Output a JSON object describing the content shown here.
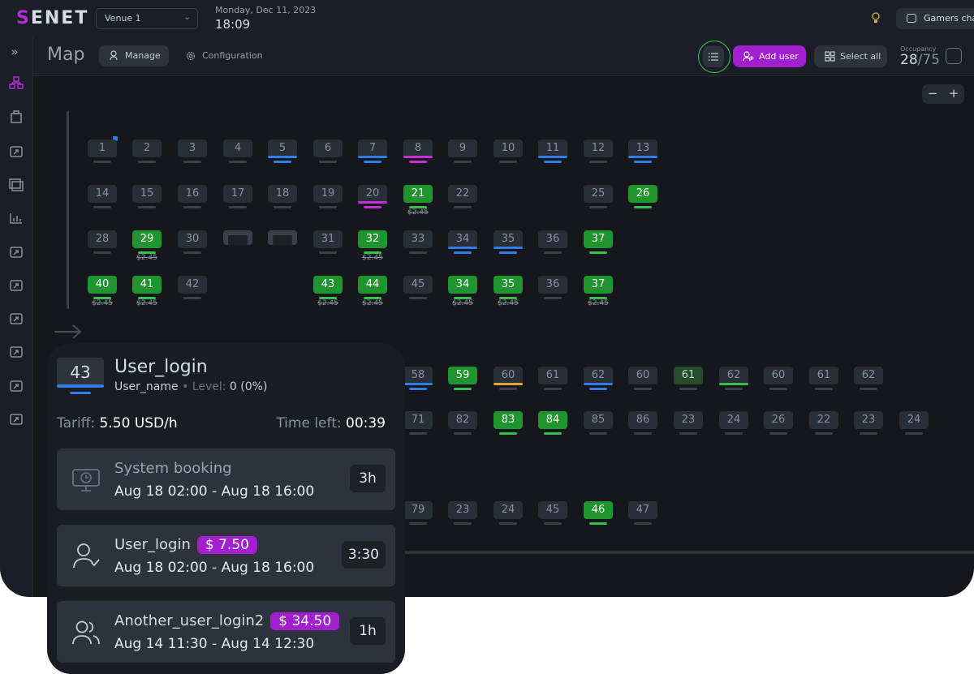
{
  "app": {
    "logo_s": "S",
    "logo_rest": "ENET"
  },
  "header": {
    "venue": "Venue 1",
    "date": "Monday, Dec 11, 2023",
    "time": "18:09",
    "gamers_button": "Gamers chat"
  },
  "toolbar": {
    "title": "Map",
    "manage": "Manage",
    "configuration": "Configuration",
    "add_user": "Add user",
    "select_all": "Select all",
    "occupancy_label": "Occupancy",
    "occupancy_current": "28",
    "occupancy_total": "/75"
  },
  "zoom": {
    "minus": "−",
    "plus": "+"
  },
  "colors": {
    "accent": "#a21fcf",
    "active_green": "#20952f",
    "blue": "#2f7ee6",
    "pink": "#c22fd3",
    "orange": "#e8a030"
  },
  "seats": [
    {
      "label": "1",
      "state": "idle"
    },
    {
      "label": "2",
      "state": "idle"
    },
    {
      "label": "3",
      "state": "idle"
    },
    {
      "label": "4",
      "state": "idle"
    },
    {
      "label": "5",
      "state": "blue"
    },
    {
      "label": "6",
      "state": "idle"
    },
    {
      "label": "7",
      "state": "blue"
    },
    {
      "label": "8",
      "state": "pink"
    },
    {
      "label": "9",
      "state": "idle"
    },
    {
      "label": "10",
      "state": "idle"
    },
    {
      "label": "11",
      "state": "blue"
    },
    {
      "label": "12",
      "state": "idle"
    },
    {
      "label": "13",
      "state": "blue"
    },
    {
      "label": "14",
      "state": "idle"
    },
    {
      "label": "15",
      "state": "idle"
    },
    {
      "label": "16",
      "state": "idle"
    },
    {
      "label": "17",
      "state": "idle"
    },
    {
      "label": "18",
      "state": "idle"
    },
    {
      "label": "19",
      "state": "idle"
    },
    {
      "label": "20",
      "state": "pink"
    },
    {
      "label": "21",
      "state": "green",
      "price": "$2.45"
    },
    {
      "label": "22",
      "state": "idle"
    },
    {
      "label": "25",
      "state": "idle"
    },
    {
      "label": "26",
      "state": "green"
    },
    {
      "label": "28",
      "state": "idle"
    },
    {
      "label": "29",
      "state": "green",
      "price": "$2.45"
    },
    {
      "label": "30",
      "state": "idle"
    },
    {
      "label": "",
      "state": "sofa"
    },
    {
      "label": "",
      "state": "sofa"
    },
    {
      "label": "31",
      "state": "idle"
    },
    {
      "label": "32",
      "state": "green",
      "price": "$2.45"
    },
    {
      "label": "33",
      "state": "idle"
    },
    {
      "label": "34",
      "state": "blue"
    },
    {
      "label": "35",
      "state": "blue"
    },
    {
      "label": "36",
      "state": "idle"
    },
    {
      "label": "37",
      "state": "green"
    },
    {
      "label": "40",
      "state": "green",
      "price": "$2.45"
    },
    {
      "label": "41",
      "state": "green",
      "price": "$2.45"
    },
    {
      "label": "42",
      "state": "idle"
    },
    {
      "label": "43",
      "state": "green",
      "price": "$2.45"
    },
    {
      "label": "44",
      "state": "green",
      "price": "$2.45"
    },
    {
      "label": "45",
      "state": "idle"
    },
    {
      "label": "34",
      "state": "green",
      "price": "$2.45"
    },
    {
      "label": "35",
      "state": "green",
      "price": "$2.45"
    },
    {
      "label": "36",
      "state": "idle"
    },
    {
      "label": "37",
      "state": "green",
      "price": "$2.45"
    },
    {
      "label": "58",
      "state": "blue"
    },
    {
      "label": "59",
      "state": "green"
    },
    {
      "label": "60",
      "state": "orange"
    },
    {
      "label": "61",
      "state": "idle"
    },
    {
      "label": "62",
      "state": "blue"
    },
    {
      "label": "60",
      "state": "idle"
    },
    {
      "label": "61",
      "state": "greendim"
    },
    {
      "label": "62",
      "state": "greenline"
    },
    {
      "label": "60",
      "state": "idle"
    },
    {
      "label": "61",
      "state": "idle"
    },
    {
      "label": "62",
      "state": "idle"
    },
    {
      "label": "71",
      "state": "idle"
    },
    {
      "label": "82",
      "state": "idle"
    },
    {
      "label": "83",
      "state": "green"
    },
    {
      "label": "84",
      "state": "green"
    },
    {
      "label": "85",
      "state": "idle"
    },
    {
      "label": "86",
      "state": "idle"
    },
    {
      "label": "23",
      "state": "idle"
    },
    {
      "label": "24",
      "state": "idle"
    },
    {
      "label": "26",
      "state": "idle"
    },
    {
      "label": "22",
      "state": "idle"
    },
    {
      "label": "23",
      "state": "idle"
    },
    {
      "label": "24",
      "state": "idle"
    },
    {
      "label": "79",
      "state": "idle"
    },
    {
      "label": "23",
      "state": "idle"
    },
    {
      "label": "24",
      "state": "idle"
    },
    {
      "label": "45",
      "state": "idle"
    },
    {
      "label": "46",
      "state": "green"
    },
    {
      "label": "47",
      "state": "idle"
    }
  ],
  "panel": {
    "seat": "43",
    "user_login": "User_login",
    "user_name": "User_name",
    "level_label": "Level:",
    "level_value": "0 (0%)",
    "tariff_label": "Tariff:",
    "tariff_value": "5.50 USD/h",
    "time_left_label": "Time left:",
    "time_left_value": "00:39",
    "bookings": [
      {
        "name": "System booking",
        "range": "Aug 18  02:00  -  Aug 18  16:00",
        "duration": "3h",
        "price": "",
        "icon": "monitor-clock-icon"
      },
      {
        "name": "User_login",
        "range": "Aug 18  02:00  -  Aug 18  16:00",
        "duration": "3:30",
        "price": "$ 7.50",
        "icon": "user-check-icon"
      },
      {
        "name": "Another_user_login2",
        "range": "Aug 14  11:30  -  Aug 14  12:30",
        "duration": "1h",
        "price": "$ 34.50",
        "icon": "users-icon"
      }
    ]
  }
}
